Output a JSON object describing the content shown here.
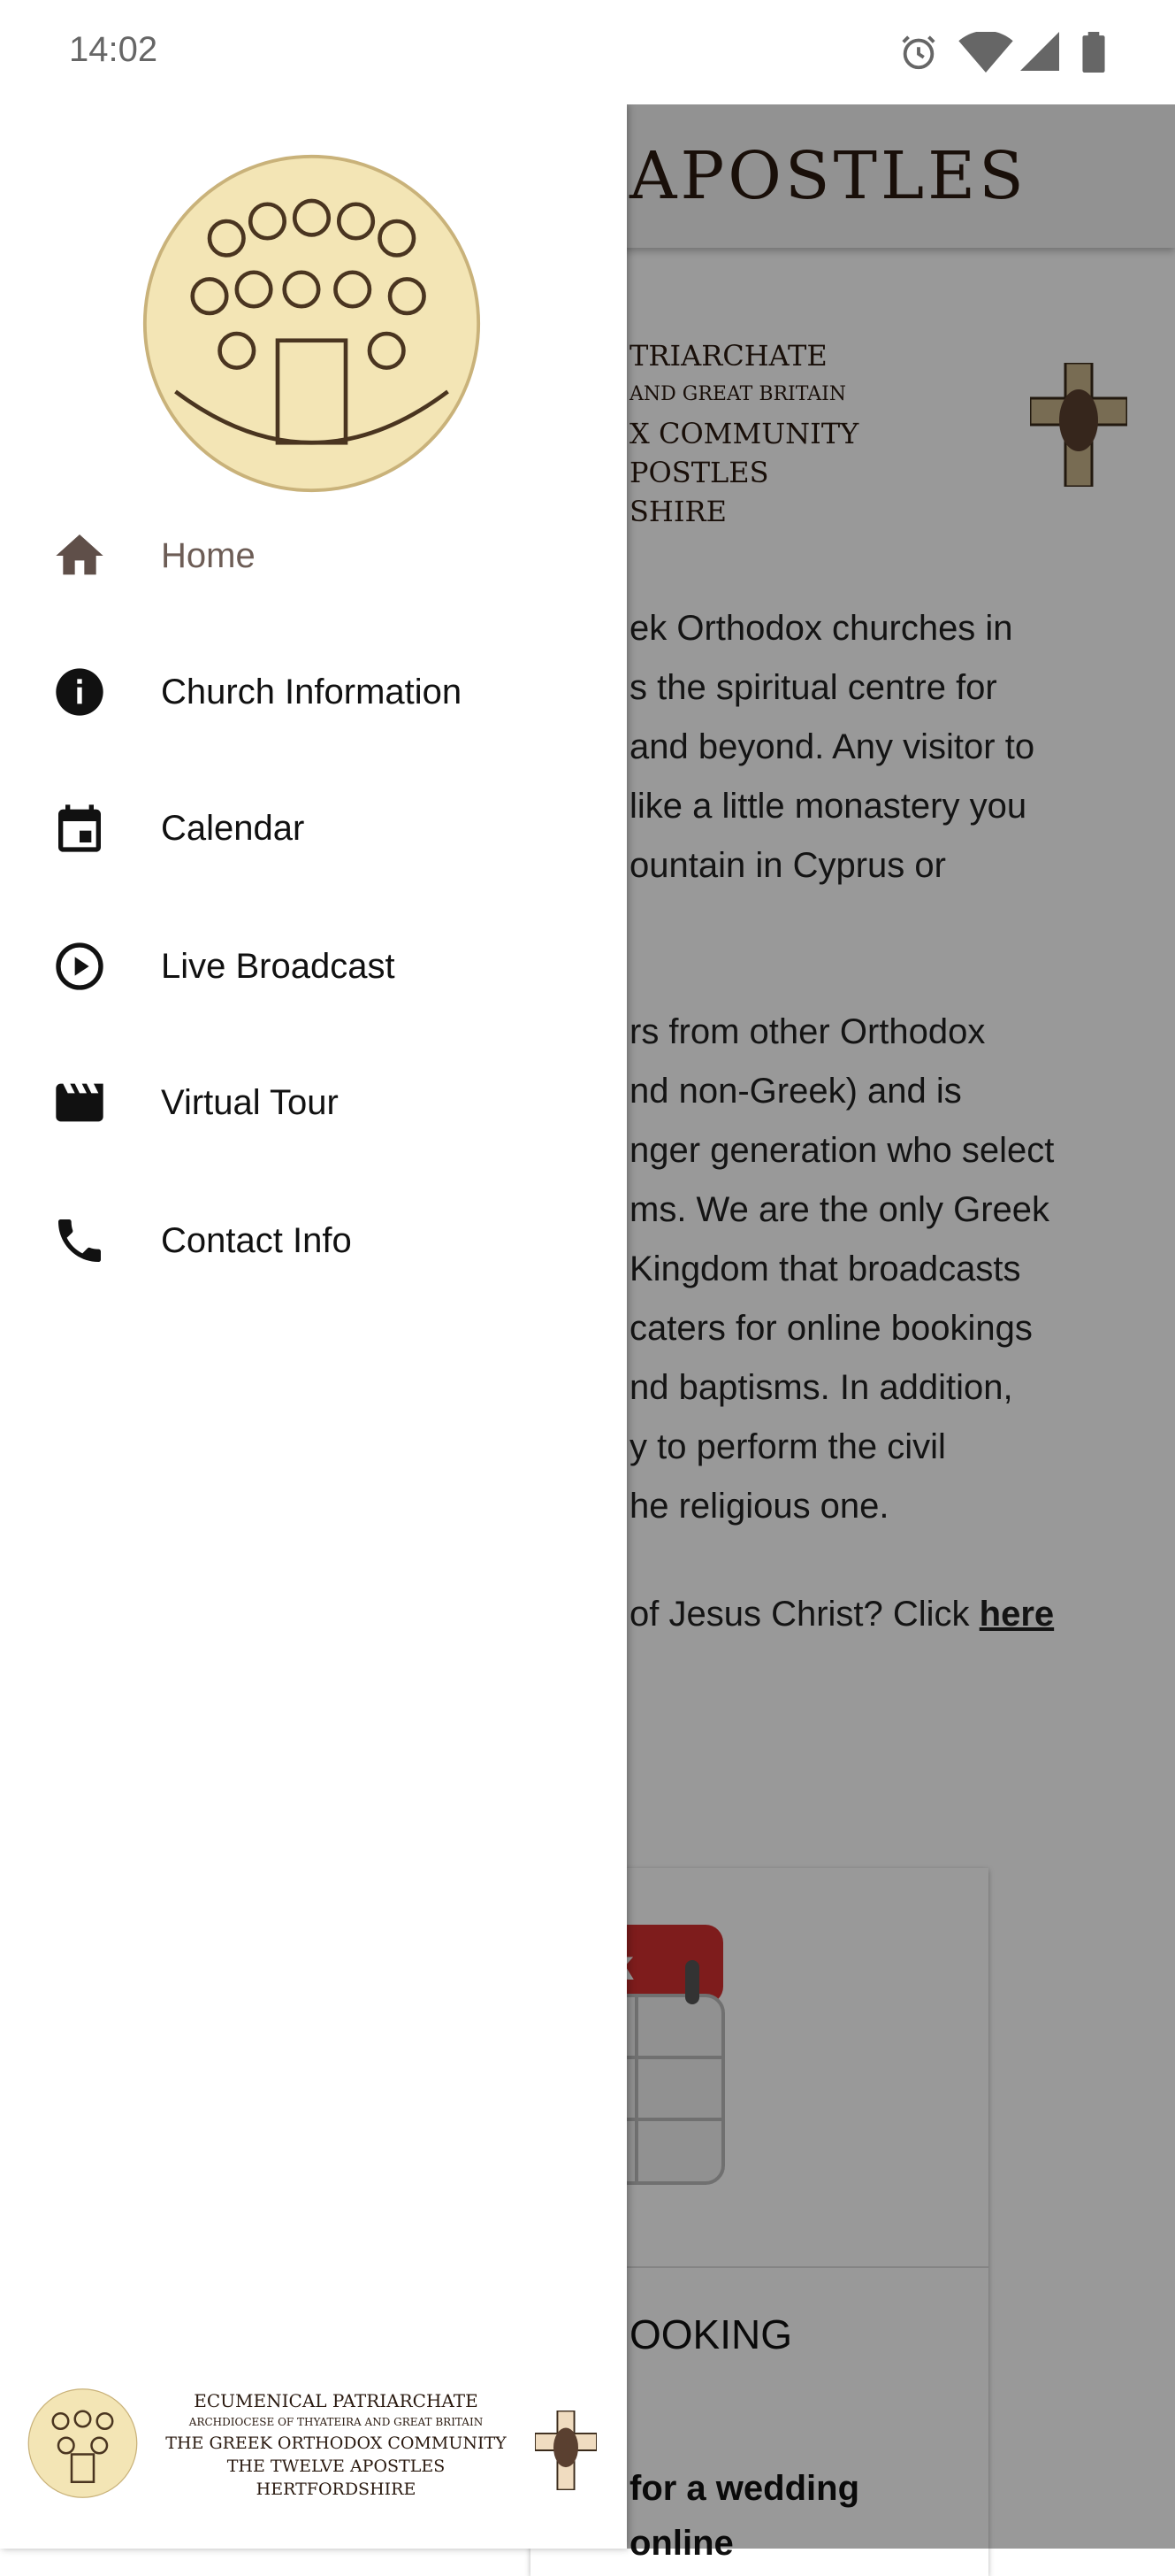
{
  "status_bar": {
    "time": "14:02",
    "icons": [
      "alarm-icon",
      "wifi-icon",
      "signal-icon",
      "battery-icon"
    ]
  },
  "background_page": {
    "app_title": "APOSTLES",
    "banner_lines": [
      "TRIARCHATE",
      "AND GREAT BRITAIN",
      "X COMMUNITY",
      "POSTLES",
      "SHIRE"
    ],
    "paragraph1": [
      "ek Orthodox churches in",
      "s the spiritual centre for",
      " and beyond. Any visitor to",
      "like a little monastery you",
      "ountain in Cyprus or"
    ],
    "paragraph2": [
      "rs from other Orthodox",
      "nd non-Greek) and is",
      "nger generation who select",
      "ms. We are the only Greek",
      "Kingdom that broadcasts",
      " caters for online bookings",
      "nd baptisms. In addition,",
      "y to perform the civil",
      "he religious one."
    ],
    "paragraph3": "of Jesus Christ? Click ",
    "link_here": "here",
    "card": {
      "title": "OOKING",
      "text": [
        " for a wedding",
        "online"
      ]
    }
  },
  "drawer": {
    "menu": [
      {
        "label": "Home",
        "icon": "home-icon",
        "active": true
      },
      {
        "label": "Church Information",
        "icon": "info-icon"
      },
      {
        "label": "Calendar",
        "icon": "calendar-icon"
      },
      {
        "label": "Live Broadcast",
        "icon": "play-circle-icon"
      },
      {
        "label": "Virtual Tour",
        "icon": "movie-icon"
      },
      {
        "label": "Contact Info",
        "icon": "phone-icon"
      }
    ],
    "footer": {
      "lines": [
        "ECUMENICAL PATRIARCHATE",
        "ARCHDIOCESE OF THYATEIRA AND GREAT BRITAIN",
        "THE GREEK ORTHODOX COMMUNITY",
        "THE TWELVE APOSTLES",
        "HERTFORDSHIRE"
      ]
    }
  },
  "colors": {
    "active_menu": "#6d5d56",
    "scrim": "rgba(0,0,0,0.4)",
    "logo_fill": "#f3e5b5",
    "calendar_red": "#d32f2f"
  }
}
